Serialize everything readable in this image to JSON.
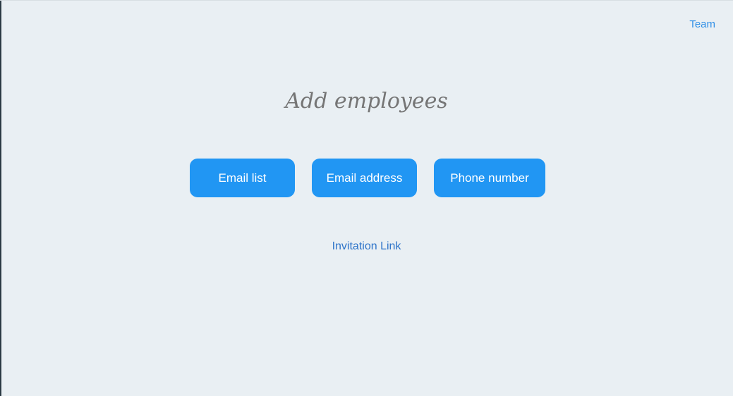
{
  "header": {
    "team_link": "Team"
  },
  "main": {
    "title": "Add employees",
    "buttons": {
      "email_list": "Email list",
      "email_address": "Email address",
      "phone_number": "Phone number"
    },
    "invitation_link": "Invitation Link"
  },
  "colors": {
    "background": "#e9eff3",
    "button": "#2196f3",
    "link": "#2f8fe6",
    "title": "#757575"
  }
}
